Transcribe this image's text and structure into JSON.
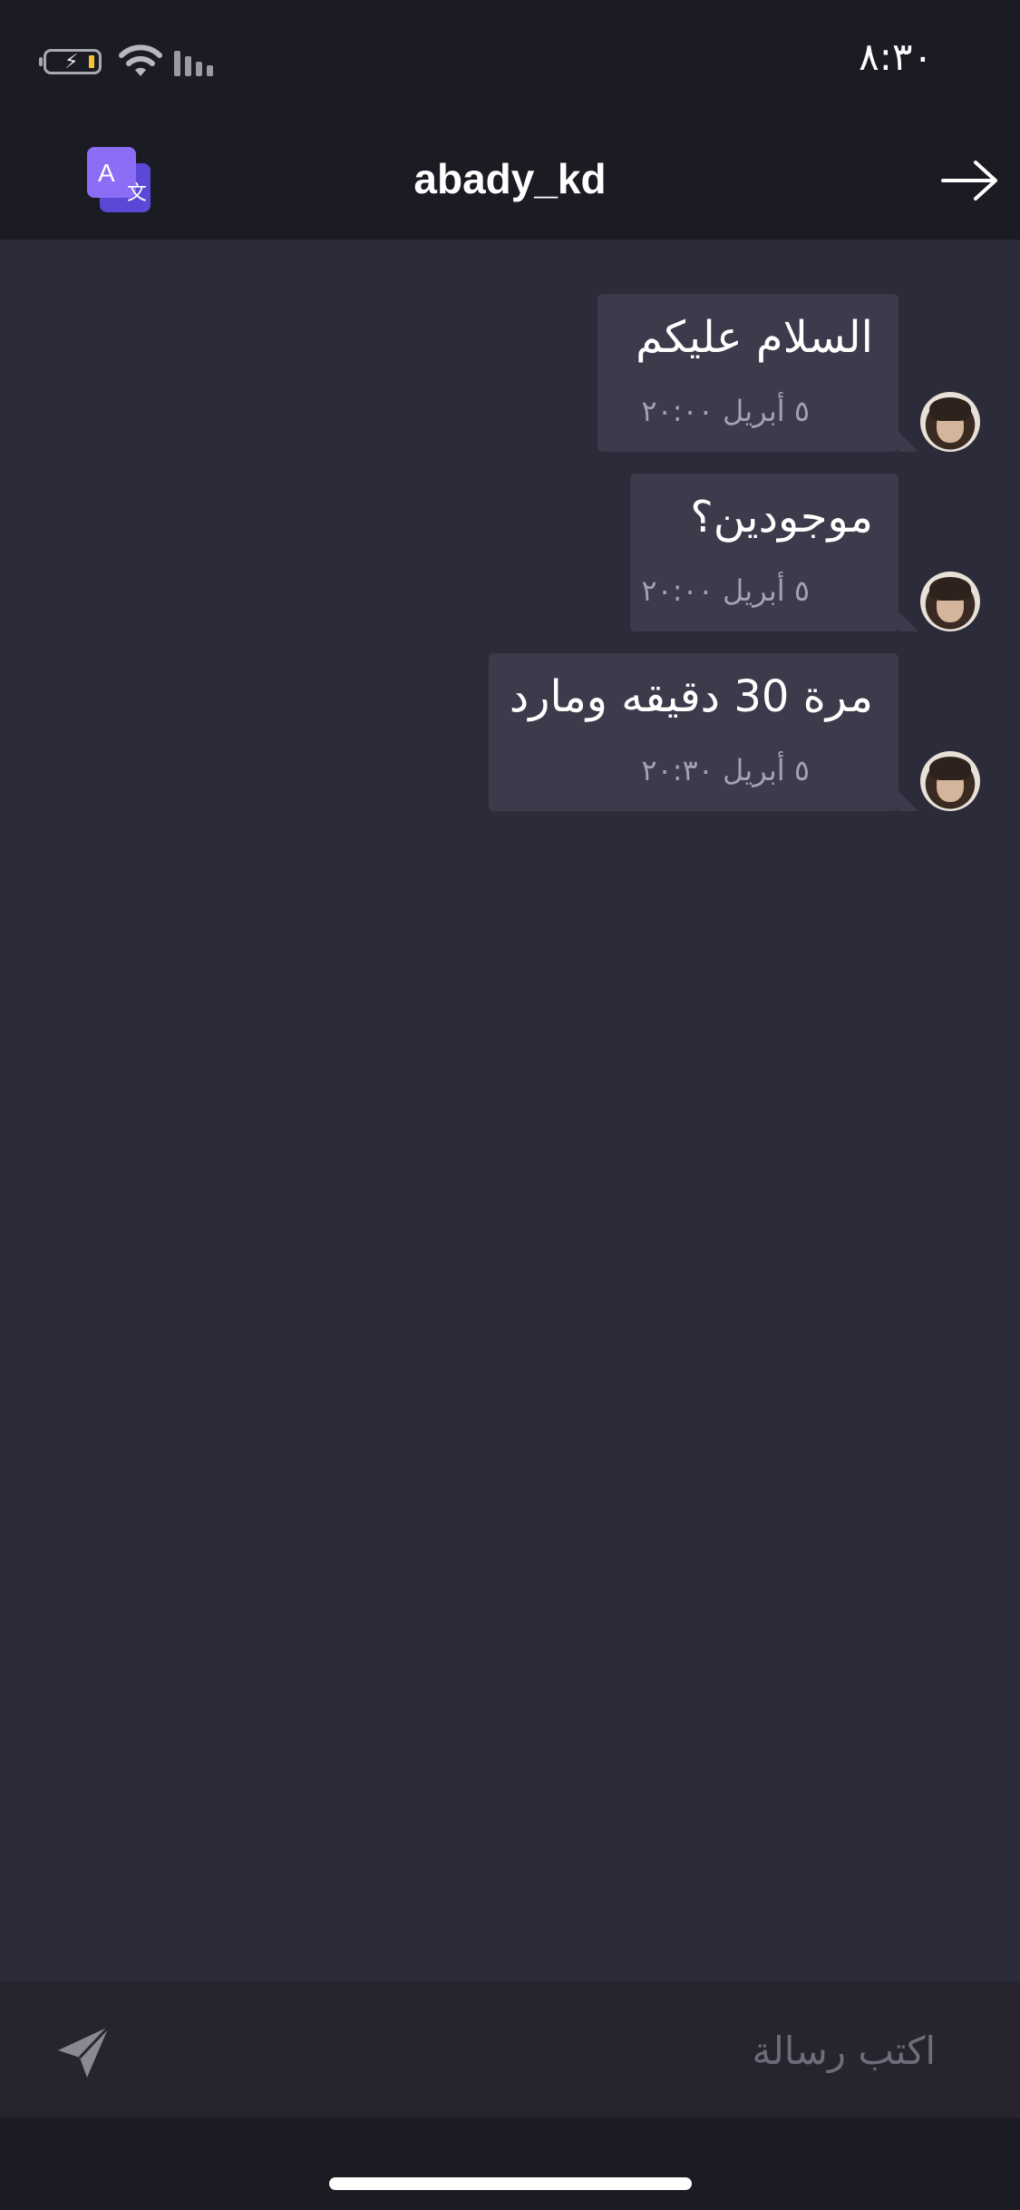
{
  "status_bar": {
    "time": "٨:٣٠",
    "battery_icon": "battery-charging-icon",
    "wifi_icon": "wifi-icon",
    "signal_icon": "cellular-signal-icon"
  },
  "header": {
    "title": "abady_kd",
    "translate_icon": "translate-icon",
    "back_icon": "arrow-right-icon"
  },
  "messages": [
    {
      "text": "السلام عليكم",
      "time": "٥ أبريل ٢٠:٠٠"
    },
    {
      "text": "موجودين؟",
      "time": "٥ أبريل ٢٠:٠٠"
    },
    {
      "text": "مرة 30 دقيقه ومارد",
      "time": "٥ أبريل ٢٠:٣٠"
    }
  ],
  "compose": {
    "placeholder": "اكتب رسالة",
    "send_icon": "send-icon"
  },
  "colors": {
    "background": "#2c2b39",
    "bar": "#1b1b24",
    "bubble": "#3c3b4b",
    "accent": "#7c5cf0"
  }
}
